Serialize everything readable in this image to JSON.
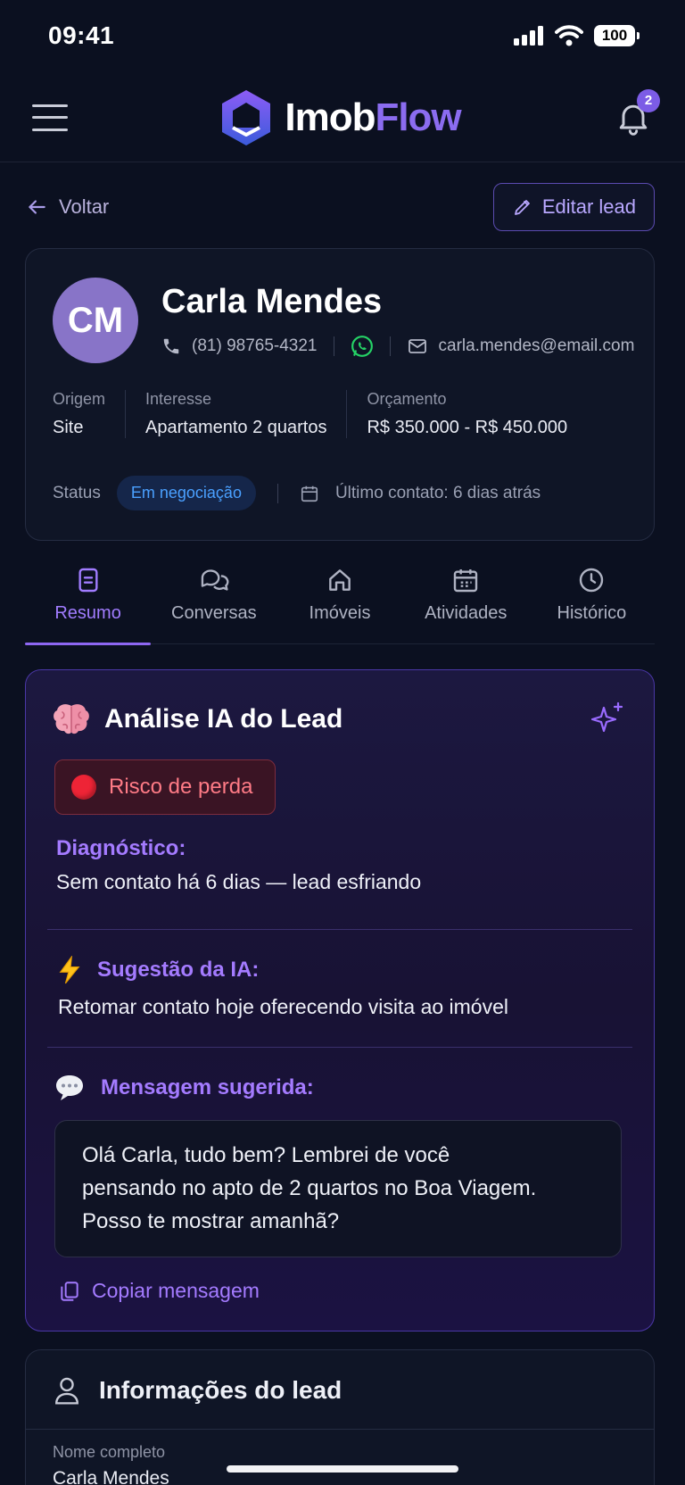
{
  "status_bar": {
    "time": "09:41",
    "battery": "100"
  },
  "app": {
    "brand_part1": "Imob",
    "brand_part2": "Flow",
    "notifications_count": "2"
  },
  "nav": {
    "back_label": "Voltar",
    "edit_label": "Editar lead"
  },
  "lead": {
    "initials": "CM",
    "name": "Carla Mendes",
    "phone": "(81) 98765-4321",
    "email": "carla.mendes@email.com",
    "origem_label": "Origem",
    "origem_value": "Site",
    "interesse_label": "Interesse",
    "interesse_value": "Apartamento 2 quartos",
    "orcamento_label": "Orçamento",
    "orcamento_value": "R$ 350.000 - R$ 450.000",
    "status_label": "Status",
    "status_value": "Em negociação",
    "last_contact": "Último contato: 6 dias atrás"
  },
  "tabs": [
    {
      "label": "Resumo",
      "active": true
    },
    {
      "label": "Conversas",
      "active": false
    },
    {
      "label": "Imóveis",
      "active": false
    },
    {
      "label": "Atividades",
      "active": false
    },
    {
      "label": "Histórico",
      "active": false
    }
  ],
  "ai": {
    "title": "Análise IA do Lead",
    "risk_label": "Risco de perda",
    "diag_label": "Diagnóstico:",
    "diag_text": "Sem contato há 6 dias — lead esfriando",
    "sugg_label": "Sugestão da IA:",
    "sugg_text": "Retomar contato hoje oferecendo visita ao imóvel",
    "msg_label": "Mensagem sugerida:",
    "msg_line1": "Olá Carla, tudo bem? Lembrei de você",
    "msg_line2": "pensando no apto de 2 quartos no Boa Viagem.",
    "msg_line3": "Posso te mostrar amanhã?",
    "copy_label": "Copiar mensagem"
  },
  "info": {
    "title": "Informações do lead",
    "full_name_label": "Nome completo",
    "full_name_value": "Carla Mendes"
  },
  "colors": {
    "accent": "#8e67f2",
    "status_blue": "#4aa0ff",
    "risk_red": "#ee2436",
    "background": "#0b1020"
  }
}
